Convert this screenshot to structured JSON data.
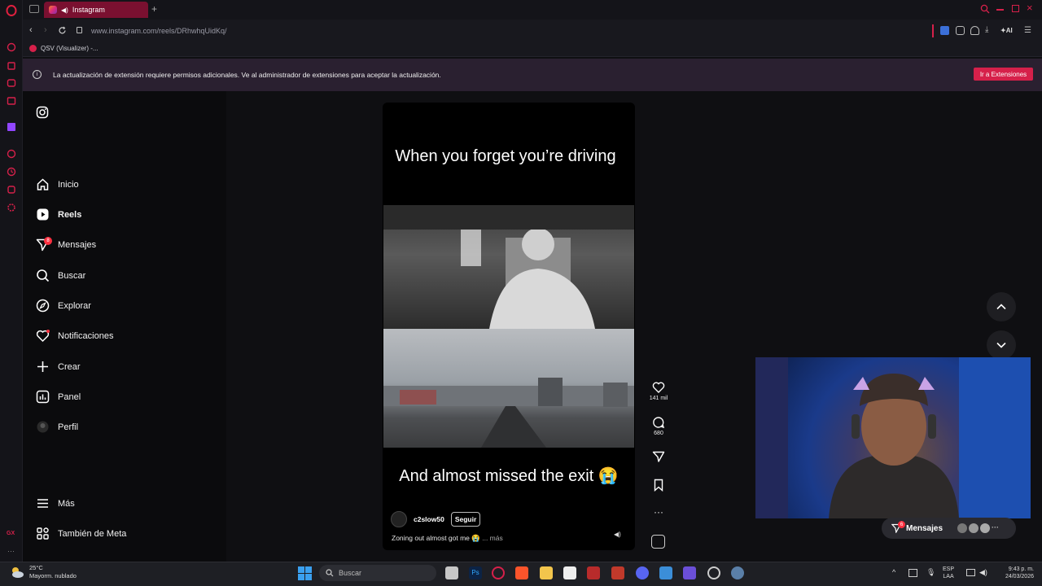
{
  "browser": {
    "tab_title": "Instagram",
    "url": "www.instagram.com/reels/DRhwhqUidKq/",
    "bookmark": "QSV (Visualizer) -...",
    "toolbar_ai_label": "AI",
    "notice_text": "La actualización de extensión requiere permisos adicionales. Ve al administrador de extensiones para aceptar la actualización.",
    "notice_button": "Ir a Extensiones",
    "side_label": "GX"
  },
  "nav": {
    "items": [
      {
        "label": "Inicio",
        "icon": "home-icon"
      },
      {
        "label": "Reels",
        "icon": "reels-icon"
      },
      {
        "label": "Mensajes",
        "icon": "messages-icon"
      },
      {
        "label": "Buscar",
        "icon": "search-icon"
      },
      {
        "label": "Explorar",
        "icon": "compass-icon"
      },
      {
        "label": "Notificaciones",
        "icon": "heart-icon"
      },
      {
        "label": "Crear",
        "icon": "plus-icon"
      },
      {
        "label": "Panel",
        "icon": "dashboard-icon"
      },
      {
        "label": "Perfil",
        "icon": "avatar-icon"
      }
    ],
    "messages_badge": "8",
    "more_label": "Más",
    "meta_label": "También de Meta"
  },
  "reel": {
    "top_text": "When you forget you’re driving",
    "bottom_text": "And almost missed the exit 😭",
    "username": "c2slow50",
    "follow_label": "Seguir",
    "caption": "Zoning out almost got me 😭",
    "more_label": "... más",
    "likes": "141 mil",
    "comments": "680"
  },
  "messages_pill": {
    "label": "Mensajes",
    "badge": "6"
  },
  "taskbar": {
    "temperature": "25°C",
    "weather": "Mayorm. nublado",
    "search_placeholder": "Buscar",
    "lang_top": "ESP",
    "lang_bottom": "LAA",
    "time": "9:43 p. m.",
    "date": "24/03/2026"
  }
}
